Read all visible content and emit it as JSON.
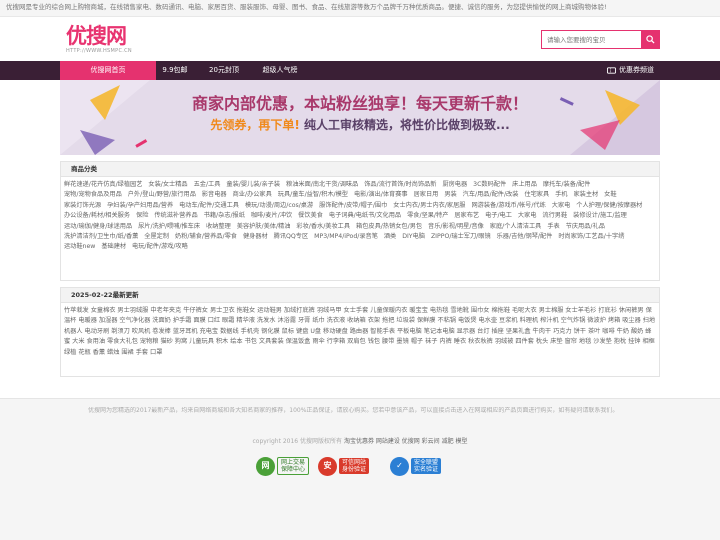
{
  "topbar": {
    "text": "优搜网是专业的综合网上购物商城，在线销售家电、数码通讯、电脑、家居百货、服装服饰、母婴、图书、食品、在线旅游等数万个品牌千万种优质商品。便捷、诚信的服务，为您提供愉悦的网上商城购物体验!"
  },
  "header": {
    "logo_text": "优搜网",
    "logo_sub": "HTTP://WWW.HSMPC.CN",
    "search_placeholder": "请输入您要搜的宝贝"
  },
  "nav": {
    "items": [
      "优搜网首页",
      "9.9包邮",
      "20元封顶",
      "超级人气榜"
    ],
    "right_label": "优惠券频道"
  },
  "banner": {
    "title": "商家内部优惠，本站粉丝独享！每天更新千款！",
    "tag": "先领券，再下单!",
    "sub": "纯人工审核精选，将性价比做到极致..."
  },
  "categories": {
    "title": "商品分类",
    "items": [
      "鲜花速递/花卉仿真/绿植园艺",
      "女装/女士精品",
      "五金/工具",
      "童装/婴儿装/亲子装",
      "粮油米面/南北干货/调味品",
      "饰品/流行首饰/时尚饰品新",
      "厨房电器",
      "3C数码配件",
      "床上用品",
      "摩托车/装备/配件",
      "宠物/宠物食品及用品",
      "户外/登山/野营/旅行用品",
      "影音电器",
      "商业/办公家具",
      "玩具/童车/益智/积木/模型",
      "电影/演出/体育赛事",
      "居家日用",
      "男装",
      "汽车/用品/配件/改装",
      "住宅家具",
      "手机",
      "家装主材",
      "女鞋",
      "家装灯饰光源",
      "孕妇装/孕产妇用品/营养",
      "电动车/配件/交通工具",
      "模玩/动漫/周边/cos/桌游",
      "服饰配件/皮带/帽子/围巾",
      "女士内衣/男士内衣/家居服",
      "网游装备/游戏币/帐号/代练",
      "大家电",
      "个人护理/保健/按摩器材",
      "办公设备/耗材/相关服务",
      "保险",
      "传统滋补营养品",
      "书籍/杂志/报纸",
      "咖啡/麦片/冲饮",
      "餐饮美食",
      "电子词典/电纸书/文化用品",
      "零食/坚果/特产",
      "居家布艺",
      "电子/电工",
      "大家电",
      "流行男鞋",
      "装修设计/施工/监理",
      "运动/瑜伽/健身/球迷用品",
      "尿片/洗护/喂哺/推车床",
      "收纳整理",
      "美容护肤/美体/精油",
      "彩妆/香水/美妆工具",
      "箱包皮具/热销女包/男包",
      "音乐/影视/明星/音像",
      "家庭/个人清洁工具",
      "手表",
      "节庆用品/礼品",
      "洗护清洁剂/卫生巾/纸/香薰",
      "全屋定制",
      "奶粉/辅食/营养品/零食",
      "健身器材",
      "腾讯QQ专区",
      "MP3/MP4/iPod/录音笔",
      "酒类",
      "DIY电脑",
      "ZIPPO/瑞士军刀/眼镜",
      "乐器/吉他/钢琴/配件",
      "时尚家饰/工艺品/十字绣",
      "运动鞋new",
      "基础建材",
      "电玩/配件/游戏/攻略"
    ]
  },
  "news": {
    "title": "2025-02-22最新更新",
    "text": "竹苹栽发 女童棉衣 男士羽绒服 中老年夹克 牛仔裤女 男士卫衣 拖鞋女 运动鞋男 加绒打底裤 羽绒马甲 女士手套 儿童保暖内衣 暖宝宝 电热毯 雪地靴 围巾女 棉拖鞋 毛呢大衣 男士棉服 女士羊毛衫 打底衫 休闲裤男 保温杯 电暖器 加湿器 空气净化器 洗面奶 护手霜 面膜 口红 眼霜 精华液 洗发水 沐浴露 牙膏 纸巾 洗衣液 收纳箱 衣架 拖把 垃圾袋 保鲜膜 不粘锅 电饭煲 电水壶 豆浆机 料理机 榨汁机 空气炸锅 微波炉 烤箱 吸尘器 扫地机器人 电动牙刷 剃须刀 吹风机 卷发棒 蓝牙耳机 充电宝 数据线 手机壳 钢化膜 鼠标 键盘 U盘 移动硬盘 路由器 智能手表 平板电脑 笔记本电脑 显示器 台灯 插座 坚果礼盒 牛肉干 巧克力 饼干 茶叶 咖啡 牛奶 酸奶 蜂蜜 大米 食用油 零食大礼包 宠物粮 猫砂 狗窝 儿童玩具 积木 绘本 书包 文具套装 保温饭盒 雨伞 行李箱 双肩包 钱包 腰带 墨镜 帽子 袜子 内裤 睡衣 秋衣秋裤 羽绒被 四件套 枕头 床垫 窗帘 地毯 沙发垫 抱枕 挂钟 相框 绿植 花瓶 香薰 蜡烛 围裙 手套 口罩"
  },
  "footer": {
    "desc": "优搜网为您精选的2017最新产品，均来自网络商城和各大知名商家的推荐，100%正品保证，请放心购买。您若中意该产品，可以直接点击进入在网或相应的产品页面进行购买，如有疑问请联系我们。",
    "copyright": "copyright 2016 优搜网版权所有",
    "links": "淘宝优惠券 网站建设 优搜网 彩云间 减肥 模型",
    "badge1_icon": "网",
    "badge1_text1": "网上交易",
    "badge1_text2": "保障中心",
    "badge2_icon": "安",
    "badge2_text1": "可信网站",
    "badge2_text2": "身份验证",
    "badge3_icon": "✓",
    "badge3_text1": "安全联盟",
    "badge3_text2": "实名验证"
  }
}
